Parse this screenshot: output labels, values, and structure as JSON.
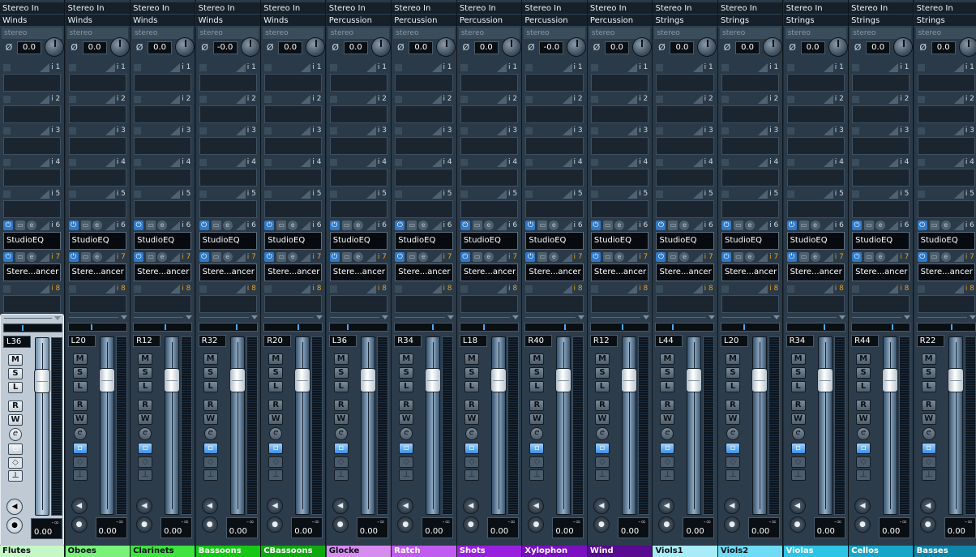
{
  "stereo_label": "stereo",
  "phase_symbol": "Ø",
  "slot_numbers": [
    "i 1",
    "i 2",
    "i 3",
    "i 4",
    "i 5",
    "i 6",
    "i 7",
    "i 8"
  ],
  "power_symbol": "⏻",
  "edit_symbol": "e",
  "buttons": {
    "mute": "M",
    "solo": "S",
    "listen": "L",
    "read": "R",
    "write": "W",
    "edit": "e"
  },
  "inf_label": "-∞",
  "channels": [
    {
      "input": "Stereo In",
      "group": "Winds",
      "gain": "0.0",
      "insert6": "StudioEQ",
      "insert7": "Stere...ancer",
      "pan": "L36",
      "pan_pos": 0.32,
      "volume": "0.00",
      "fader_level": 0.2,
      "name": "Flutes",
      "name_color": "#c6f7c6",
      "name_text_dark": true,
      "selected": true
    },
    {
      "input": "Stereo In",
      "group": "Winds",
      "gain": "0.0",
      "insert6": "StudioEQ",
      "insert7": "Stere...ancer",
      "pan": "L20",
      "pan_pos": 0.4,
      "volume": "0.00",
      "fader_level": 0.2,
      "name": "Oboes",
      "name_color": "#79f279",
      "name_text_dark": true,
      "selected": false
    },
    {
      "input": "Stereo In",
      "group": "Winds",
      "gain": "0.0",
      "insert6": "StudioEQ",
      "insert7": "Stere...ancer",
      "pan": "R12",
      "pan_pos": 0.56,
      "volume": "0.00",
      "fader_level": 0.2,
      "name": "Clarinets",
      "name_color": "#3fe43f",
      "name_text_dark": true,
      "selected": false
    },
    {
      "input": "Stereo In",
      "group": "Winds",
      "gain": "-0.0",
      "insert6": "StudioEQ",
      "insert7": "Stere...ancer",
      "pan": "R32",
      "pan_pos": 0.66,
      "volume": "0.00",
      "fader_level": 0.2,
      "name": "Bassoons",
      "name_color": "#14c814",
      "name_text_dark": false,
      "selected": false
    },
    {
      "input": "Stereo In",
      "group": "Winds",
      "gain": "0.0",
      "insert6": "StudioEQ",
      "insert7": "Stere...ancer",
      "pan": "R20",
      "pan_pos": 0.6,
      "volume": "0.00",
      "fader_level": 0.2,
      "name": "CBassoons",
      "name_color": "#0ea90e",
      "name_text_dark": false,
      "selected": false
    },
    {
      "input": "Stereo In",
      "group": "Percussion",
      "gain": "0.0",
      "insert6": "StudioEQ",
      "insert7": "Stere...ancer",
      "pan": "L36",
      "pan_pos": 0.32,
      "volume": "0.00",
      "fader_level": 0.2,
      "name": "Glocke",
      "name_color": "#d98cf0",
      "name_text_dark": true,
      "selected": false
    },
    {
      "input": "Stereo In",
      "group": "Percussion",
      "gain": "0.0",
      "insert6": "StudioEQ",
      "insert7": "Stere...ancer",
      "pan": "R34",
      "pan_pos": 0.67,
      "volume": "0.00",
      "fader_level": 0.2,
      "name": "Ratch",
      "name_color": "#c25cf0",
      "name_text_dark": false,
      "selected": false
    },
    {
      "input": "Stereo In",
      "group": "Percussion",
      "gain": "0.0",
      "insert6": "StudioEQ",
      "insert7": "Stere...ancer",
      "pan": "L18",
      "pan_pos": 0.41,
      "volume": "0.00",
      "fader_level": 0.2,
      "name": "Shots",
      "name_color": "#9a20e0",
      "name_text_dark": false,
      "selected": false
    },
    {
      "input": "Stereo In",
      "group": "Percussion",
      "gain": "-0.0",
      "insert6": "StudioEQ",
      "insert7": "Stere...ancer",
      "pan": "R40",
      "pan_pos": 0.7,
      "volume": "0.00",
      "fader_level": 0.2,
      "name": "Xylophon",
      "name_color": "#7a10c0",
      "name_text_dark": false,
      "selected": false
    },
    {
      "input": "Stereo In",
      "group": "Percussion",
      "gain": "0.0",
      "insert6": "StudioEQ",
      "insert7": "Stere...ancer",
      "pan": "R12",
      "pan_pos": 0.56,
      "volume": "0.00",
      "fader_level": 0.2,
      "name": "Wind",
      "name_color": "#580a90",
      "name_text_dark": false,
      "selected": false
    },
    {
      "input": "Stereo In",
      "group": "Strings",
      "gain": "0.0",
      "insert6": "StudioEQ",
      "insert7": "Stere...ancer",
      "pan": "L44",
      "pan_pos": 0.28,
      "volume": "0.00",
      "fader_level": 0.2,
      "name": "Viols1",
      "name_color": "#a8ecfa",
      "name_text_dark": true,
      "selected": false
    },
    {
      "input": "Stereo In",
      "group": "Strings",
      "gain": "0.0",
      "insert6": "StudioEQ",
      "insert7": "Stere...ancer",
      "pan": "L20",
      "pan_pos": 0.4,
      "volume": "0.00",
      "fader_level": 0.2,
      "name": "Viols2",
      "name_color": "#6edcf5",
      "name_text_dark": true,
      "selected": false
    },
    {
      "input": "Stereo In",
      "group": "Strings",
      "gain": "0.0",
      "insert6": "StudioEQ",
      "insert7": "Stere...ancer",
      "pan": "R34",
      "pan_pos": 0.67,
      "volume": "0.00",
      "fader_level": 0.2,
      "name": "Violas",
      "name_color": "#2ec4e6",
      "name_text_dark": false,
      "selected": false
    },
    {
      "input": "Stereo In",
      "group": "Strings",
      "gain": "0.0",
      "insert6": "StudioEQ",
      "insert7": "Stere...ancer",
      "pan": "R44",
      "pan_pos": 0.72,
      "volume": "0.00",
      "fader_level": 0.2,
      "name": "Cellos",
      "name_color": "#16a6c8",
      "name_text_dark": false,
      "selected": false
    },
    {
      "input": "Stereo In",
      "group": "Strings",
      "gain": "0.0",
      "insert6": "StudioEQ",
      "insert7": "Stere...ancer",
      "pan": "R22",
      "pan_pos": 0.61,
      "volume": "0.00",
      "fader_level": 0.2,
      "name": "Basses",
      "name_color": "#0d86a8",
      "name_text_dark": false,
      "selected": false
    }
  ]
}
